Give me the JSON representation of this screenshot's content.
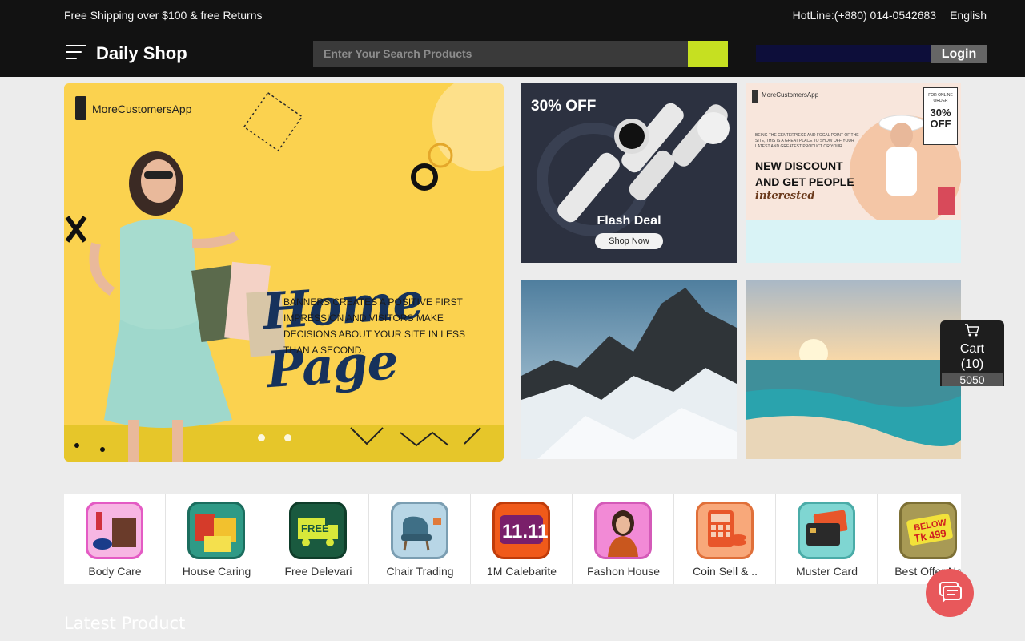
{
  "topbar": {
    "promo": "Free Shipping over $100 & free Returns",
    "hotline": "HotLine:(+880) 014-0542683",
    "language": "English"
  },
  "header": {
    "brand": "Daily Shop",
    "search_placeholder": "Enter Your Search Products",
    "login_label": "Login"
  },
  "hero": {
    "logo_text": "MoreCustomersApp",
    "title": "Home Page",
    "copy": "Banners creates a positive first impression and visitors make decisions about your site in less than a second.",
    "accent_color": "#fbd24f"
  },
  "tiles": {
    "watch": {
      "discount": "30% OFF",
      "title": "Flash Deal",
      "cta": "Shop Now"
    },
    "discount": {
      "logo": "MoreCustomersApp",
      "small_text": "Being the centerpiece and focal point of the site, this is a great place to show off your latest and greatest product or your",
      "headline_1": "NEW DISCOUNT",
      "headline_2": "AND GET PEOPLE",
      "script": "interested",
      "badge_small": "FOR ONLINE ORDER",
      "badge_big": "30% OFF"
    }
  },
  "cart": {
    "label": "Cart",
    "count": "(10)",
    "total": "5050",
    "icon": "cart-icon"
  },
  "categories": [
    {
      "label": "Body Care"
    },
    {
      "label": "House Caring"
    },
    {
      "label": "Free Delevari"
    },
    {
      "label": "Chair Trading"
    },
    {
      "label": "1M Calebarite"
    },
    {
      "label": "Fashon House"
    },
    {
      "label": "Coin Sell & .."
    },
    {
      "label": "Muster Card"
    },
    {
      "label": "Best Offer No"
    }
  ],
  "category_art": {
    "free_text": "FREE",
    "elevenEleven": "11.11",
    "below_text": "BELOW",
    "tk_text": "Tk 499"
  },
  "section": {
    "latest_title": "Latest Product"
  },
  "colors": {
    "search_button": "#c6e021",
    "chat": "#e8585b",
    "header": "#121212"
  }
}
